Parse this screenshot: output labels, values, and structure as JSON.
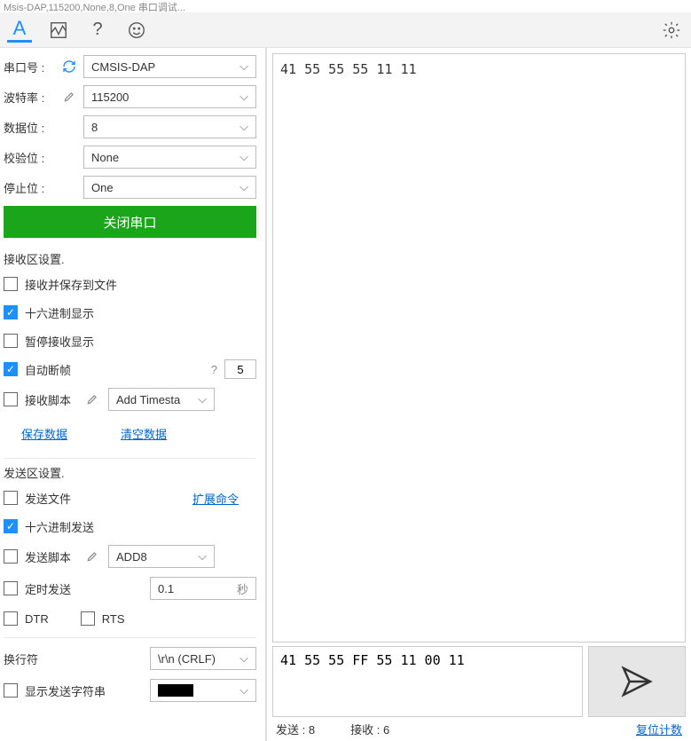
{
  "title_fragment": "Msis-DAP,115200,None,8,One  串口调试...",
  "toolbar": {
    "letter": "A"
  },
  "port": {
    "label": "串口号 :",
    "value": "CMSIS-DAP"
  },
  "baud": {
    "label": "波特率 :",
    "value": "115200"
  },
  "databits": {
    "label": "数据位 :",
    "value": "8"
  },
  "parity": {
    "label": "校验位 :",
    "value": "None"
  },
  "stopbits": {
    "label": "停止位 :",
    "value": "One"
  },
  "close_port_btn": "关闭串口",
  "recv_section": "接收区设置.",
  "recv_save_file": "接收并保存到文件",
  "recv_hex": "十六进制显示",
  "recv_pause": "暂停接收显示",
  "recv_auto_break": "自动断帧",
  "recv_auto_break_hint": "?",
  "recv_auto_break_value": "5",
  "recv_script": "接收脚本",
  "recv_script_select": "Add Timesta",
  "save_data_link": "保存数据",
  "clear_data_link": "清空数据",
  "send_section": "发送区设置.",
  "send_file": "发送文件",
  "extend_cmd_link": "扩展命令",
  "send_hex": "十六进制发送",
  "send_script": "发送脚本",
  "send_script_select": "ADD8",
  "send_timed": "定时发送",
  "send_timed_value": "0.1",
  "send_timed_unit": "秒",
  "dtr": "DTR",
  "rts": "RTS",
  "newline_label": "换行符",
  "newline_value": "\\r\\n (CRLF)",
  "show_send_str": "显示发送字符串",
  "receive_text": "41 55 55 55 11 11",
  "send_text": "41 55 55 FF 55 11 00 11",
  "status_send_label": "发送 :",
  "status_send_count": "8",
  "status_recv_label": "接收 :",
  "status_recv_count": "6",
  "reset_counter_link": "复位计数"
}
